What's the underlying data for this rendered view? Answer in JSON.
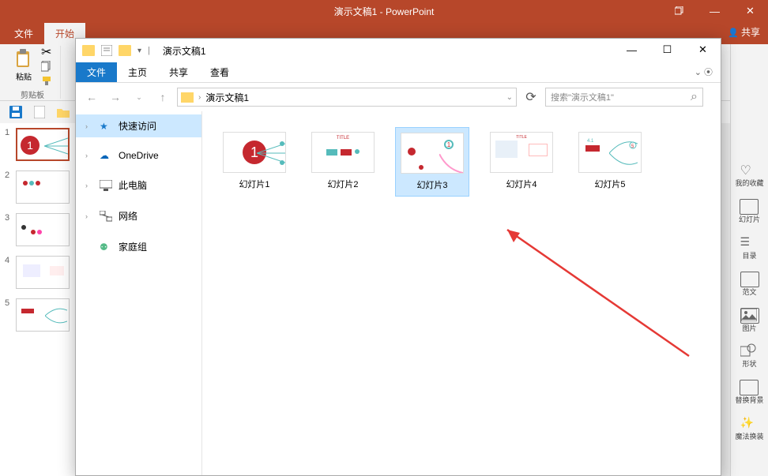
{
  "ppt": {
    "title": "演示文稿1 - PowerPoint",
    "tabs": {
      "file": "文件",
      "start": "开始"
    },
    "share": "共享",
    "clipboard": {
      "paste": "粘贴",
      "label": "剪贴板"
    },
    "slides": [
      {
        "num": "1"
      },
      {
        "num": "2"
      },
      {
        "num": "3"
      },
      {
        "num": "4"
      },
      {
        "num": "5"
      }
    ],
    "sidebar": {
      "collection": "我的收藏",
      "slide": "幻灯片",
      "toc": "目录",
      "template": "范文",
      "image": "图片",
      "shape": "形状",
      "bg": "替换背景",
      "magic": "魔法换装"
    }
  },
  "explorer": {
    "title": "演示文稿1",
    "tabs": {
      "file": "文件",
      "home": "主页",
      "share": "共享",
      "view": "查看"
    },
    "breadcrumb": "演示文稿1",
    "search_placeholder": "搜索\"演示文稿1\"",
    "sidebar": {
      "quickaccess": "快速访问",
      "onedrive": "OneDrive",
      "thispc": "此电脑",
      "network": "网络",
      "homegroup": "家庭组"
    },
    "files": [
      {
        "name": "幻灯片1"
      },
      {
        "name": "幻灯片2"
      },
      {
        "name": "幻灯片3"
      },
      {
        "name": "幻灯片4"
      },
      {
        "name": "幻灯片5"
      }
    ]
  }
}
